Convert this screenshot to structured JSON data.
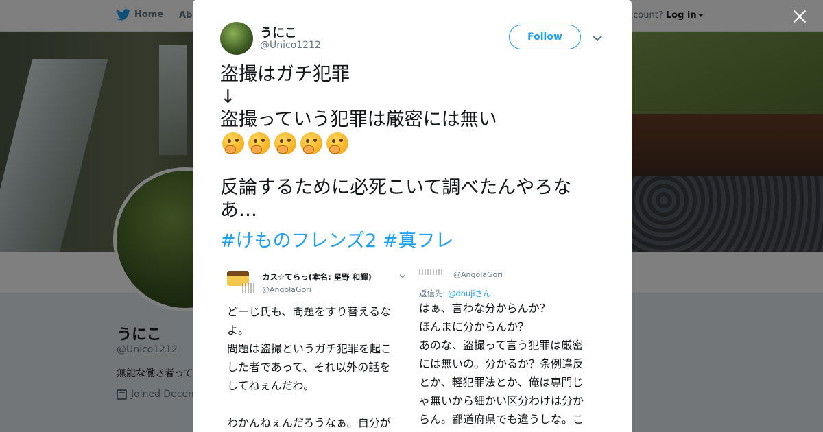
{
  "nav": {
    "home_label": "Home",
    "about_label": "Abo",
    "login_prompt": "ccount?",
    "login_label": "Log in"
  },
  "profile": {
    "name": "うにこ",
    "handle": "@Unico1212",
    "bio": "無能な働き者って",
    "joined": "Joined Decem"
  },
  "modal": {
    "author_name": "うにこ",
    "author_handle": "@Unico1212",
    "follow_label": "Follow",
    "tweet_lines": [
      "盗撮はガチ犯罪",
      "↓",
      "盗撮っていう犯罪は厳密には無い"
    ],
    "emoji_count": 5,
    "emoji_name": "thinking-face",
    "tweet_lines_2": [
      "反論するために必死こいて調べたんやろな",
      "あ…"
    ],
    "hashtags": "#けものフレンズ2 #真フレ"
  },
  "attached_left": {
    "name": "カス☆てらっ(本名: 星野 和輝)",
    "handle": "@AngolaGori",
    "lines": [
      "どーじ氏も、問題をすり替えるな",
      "よ。",
      "問題は盗撮というガチ犯罪を起こ",
      "した者であって、それ以外の話を",
      "してねぇんだわ。",
      "",
      "わかんねぇんだろうなぁ。自分が"
    ]
  },
  "attached_right": {
    "handle": "@AngolaGori",
    "reply_prefix": "返信先:",
    "reply_to": "@doujiさん",
    "lines": [
      "はぁ、言わな分からんか？",
      "ほんまに分からんか？",
      "あのな、盗撮って言う犯罪は厳密",
      "には無いの。分かるか？条例違反",
      "とか、軽犯罪法とか、俺は専門じ",
      "ゃ無いから細かい区分わけは分か",
      "らん。都道府県でも違うしな。こ"
    ]
  },
  "colors": {
    "accent": "#1da1f2",
    "text": "#14171a",
    "muted": "#657786"
  }
}
